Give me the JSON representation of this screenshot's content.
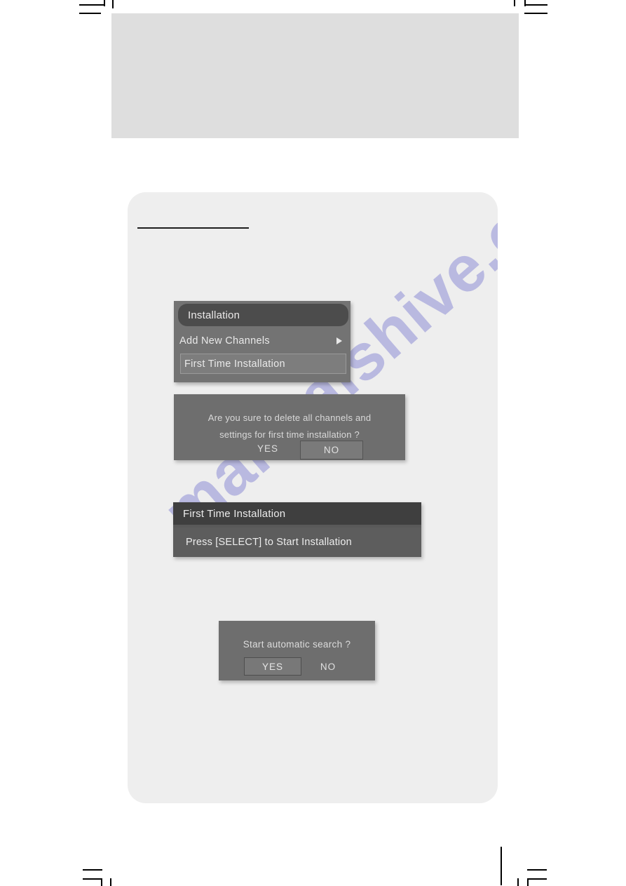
{
  "page": {
    "background_color": "#ffffff",
    "panel_color": "#eeeeee",
    "placeholder_color": "#dedede"
  },
  "watermark": {
    "text": "manualshive.com",
    "color": "#9a9ad8"
  },
  "osd": {
    "installation_menu": {
      "title": "Installation",
      "items": [
        {
          "label": "Add New Channels",
          "icon": "arrow-right-icon",
          "has_submenu": true,
          "selected": false
        },
        {
          "label": "First Time Installation",
          "has_submenu": false,
          "selected": true
        }
      ]
    },
    "confirm_delete_dialog": {
      "line1": "Are you sure to delete all channels and",
      "line2": "settings for first time installation ?",
      "yes_label": "YES",
      "no_label": "NO",
      "focused_button": "NO"
    },
    "first_time_installation_screen": {
      "title": "First Time Installation",
      "body": "Press [SELECT] to Start Installation"
    },
    "auto_search_dialog": {
      "question": "Start automatic search ?",
      "yes_label": "YES",
      "no_label": "NO",
      "focused_button": "YES"
    }
  }
}
